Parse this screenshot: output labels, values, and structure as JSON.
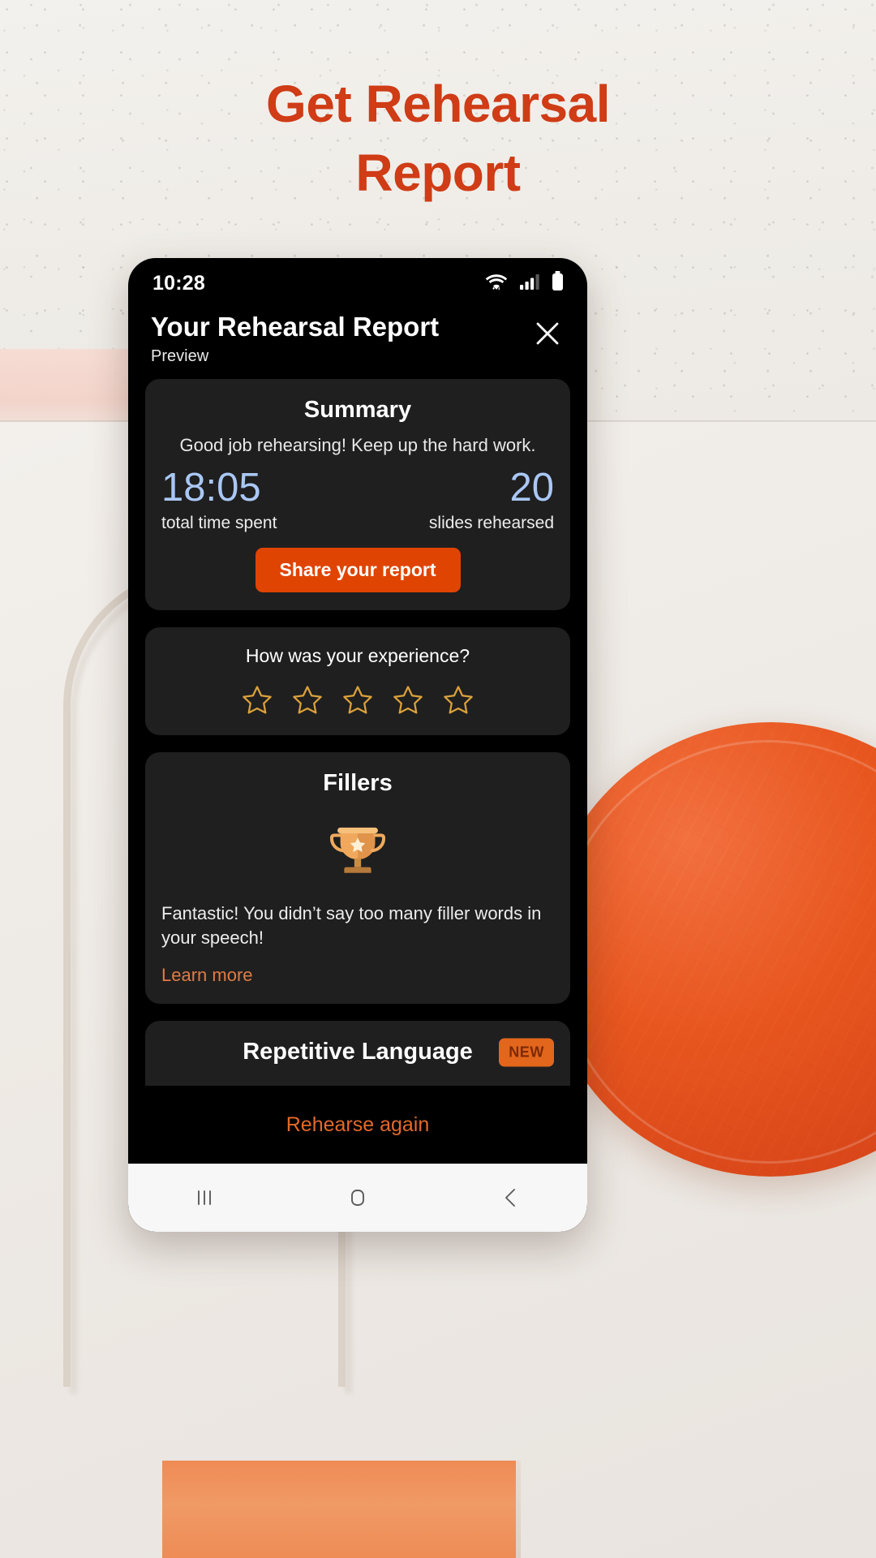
{
  "promo": {
    "headline_line1": "Get Rehearsal",
    "headline_line2": "Report",
    "headline_color": "#cf3c16"
  },
  "phone": {
    "status_bar": {
      "time": "10:28",
      "icons": [
        "wifi-icon",
        "cellular-signal-icon",
        "battery-icon"
      ]
    },
    "header": {
      "title": "Your Rehearsal Report",
      "subtitle": "Preview",
      "close_label": "Close"
    },
    "summary_card": {
      "title": "Summary",
      "message": "Good job rehearsing! Keep up the hard work.",
      "stats": [
        {
          "value": "18:05",
          "label": "total time spent"
        },
        {
          "value": "20",
          "label": "slides rehearsed"
        }
      ],
      "share_button": "Share your report",
      "value_color": "#a9c7f5",
      "button_color": "#e04403"
    },
    "experience_card": {
      "question": "How was your experience?",
      "star_count": 5,
      "stars_filled": 0,
      "star_color": "#dba13c"
    },
    "fillers_card": {
      "title": "Fillers",
      "icon": "trophy-icon",
      "body": "Fantastic! You didn’t say too many filler words in your speech!",
      "link": "Learn more",
      "link_color": "#e07b45"
    },
    "repetitive_card": {
      "title": "Repetitive Language",
      "badge": "NEW",
      "badge_bg": "#e2661c",
      "badge_fg": "#7d2a05",
      "icon": "trophy-icon"
    },
    "bottom_action": {
      "label": "Rehearse again",
      "color": "#e3692a"
    },
    "nav_bar": {
      "recents_label": "Recents",
      "home_label": "Home",
      "back_label": "Back"
    }
  }
}
